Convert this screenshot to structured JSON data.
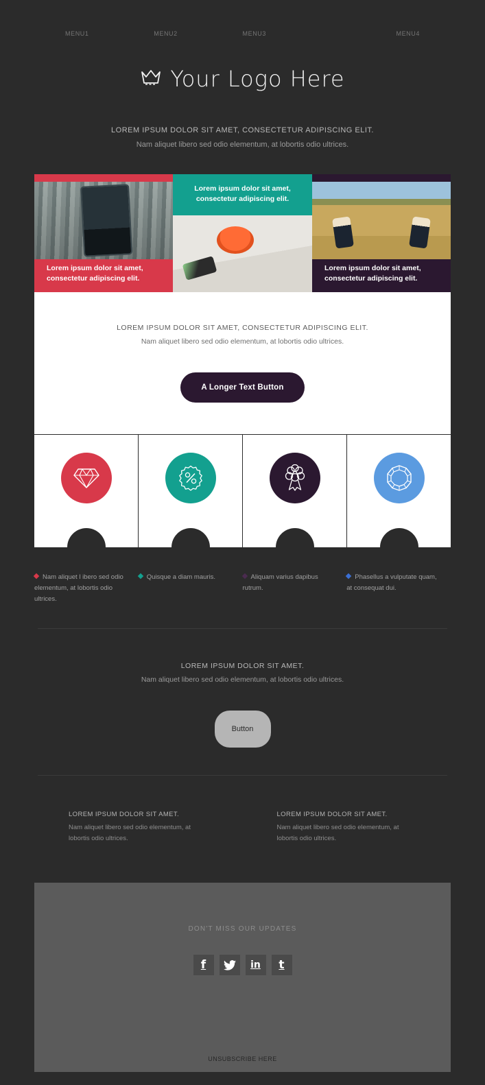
{
  "colors": {
    "background": "#2b2b2b",
    "red": "#d8394a",
    "teal": "#13a08f",
    "purple": "#2b1830",
    "blue": "#5b9be0",
    "footer_grey": "#5b5b5b",
    "button_grey": "#b5b5b5"
  },
  "topnav": {
    "items": [
      {
        "label": "MENU1"
      },
      {
        "label": "MENU2"
      },
      {
        "label": "MENU3"
      },
      {
        "label": "MENU4"
      }
    ]
  },
  "logo": {
    "icon": "crown-icon",
    "text": "Your Logo Here"
  },
  "intro": {
    "headline": "LOREM IPSUM DOLOR SIT AMET, CONSECTETUR ADIPISCING ELIT.",
    "subtext": "Nam aliquet libero sed odio elementum, at lobortis odio ultrices."
  },
  "panels": [
    {
      "caption": "Lorem ipsum dolor sit amet, consectetur adipiscing elit.",
      "accent": "#d8394a",
      "caption_position": "bottom",
      "photo": "hand-holding-phone-city-photo"
    },
    {
      "caption": "Lorem ipsum dolor sit amet, consectetur adipiscing elit.",
      "accent": "#13a08f",
      "caption_position": "top",
      "photo": "coffee-cup-desk-photo"
    },
    {
      "caption": "Lorem ipsum dolor sit amet, consectetur adipiscing elit.",
      "accent": "#2b1830",
      "caption_position": "bottom",
      "photo": "sneakers-in-field-photo"
    }
  ],
  "white_block": {
    "headline": "LOREM IPSUM DOLOR SIT AMET, CONSECTETUR ADIPISCING ELIT.",
    "subtext": "Nam aliquet libero sed odio elementum, at lobortis odio ultrices.",
    "button_label": "A Longer Text Button"
  },
  "feature_icons": [
    {
      "icon": "diamond-icon",
      "color": "#d8394a"
    },
    {
      "icon": "percent-badge-icon",
      "color": "#13a08f"
    },
    {
      "icon": "award-ribbon-icon",
      "color": "#2b1830"
    },
    {
      "icon": "gem-icon",
      "color": "#5b9be0"
    }
  ],
  "bullets": [
    {
      "text": "Nam aliquet l ibero sed odio elementum, at lobortis odio ultrices.",
      "color": "#d8394a"
    },
    {
      "text": "Quisque a diam mauris.",
      "color": "#13a08f"
    },
    {
      "text": "Aliquam varius dapibus rutrum.",
      "color": "#4a2b4f"
    },
    {
      "text": "Phasellus a vulputate quam, at consequat dui.",
      "color": "#3b6fd4"
    }
  ],
  "mid_section": {
    "headline": "LOREM IPSUM DOLOR SIT AMET.",
    "subtext": "Nam aliquet libero sed odio elementum, at lobortis odio ultrices.",
    "button_label": "Button"
  },
  "two_columns": [
    {
      "headline": "LOREM IPSUM DOLOR SIT AMET.",
      "body": "Nam aliquet libero sed odio elementum, at lobortis odio ultrices."
    },
    {
      "headline": "LOREM IPSUM DOLOR SIT AMET.",
      "body": "Nam aliquet libero sed odio elementum, at lobortis odio ultrices."
    }
  ],
  "footer": {
    "title": "DON'T MISS OUR UPDATES",
    "social": [
      {
        "name": "facebook-icon",
        "glyph": "f"
      },
      {
        "name": "twitter-icon",
        "glyph": ""
      },
      {
        "name": "linkedin-icon",
        "glyph": "in"
      },
      {
        "name": "tumblr-icon",
        "glyph": "t"
      }
    ],
    "unsubscribe_label": "UNSUBSCRIBE HERE"
  }
}
